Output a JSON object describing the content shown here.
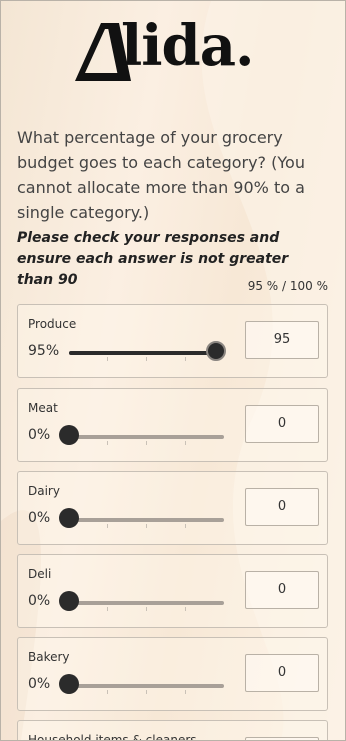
{
  "brand": {
    "logo_text": "lida."
  },
  "survey": {
    "question": "What percentage of your grocery budget goes to each category? (You cannot allocate more than 90% to a single category.)",
    "instruction": "Please check your responses and ensure each answer is not greater than 90",
    "total": "95 % / 100 %",
    "items": [
      {
        "label": "Produce",
        "percent_display": "95%",
        "value": "95",
        "level": 0.95
      },
      {
        "label": "Meat",
        "percent_display": "0%",
        "value": "0",
        "level": 0
      },
      {
        "label": "Dairy",
        "percent_display": "0%",
        "value": "0",
        "level": 0
      },
      {
        "label": "Deli",
        "percent_display": "0%",
        "value": "0",
        "level": 0
      },
      {
        "label": "Bakery",
        "percent_display": "0%",
        "value": "0",
        "level": 0
      },
      {
        "label": "Household items & cleaners"
      }
    ]
  },
  "colors": {
    "accent": "#2b2b2b",
    "track": "#a8a098",
    "background": "#f6ead9"
  }
}
